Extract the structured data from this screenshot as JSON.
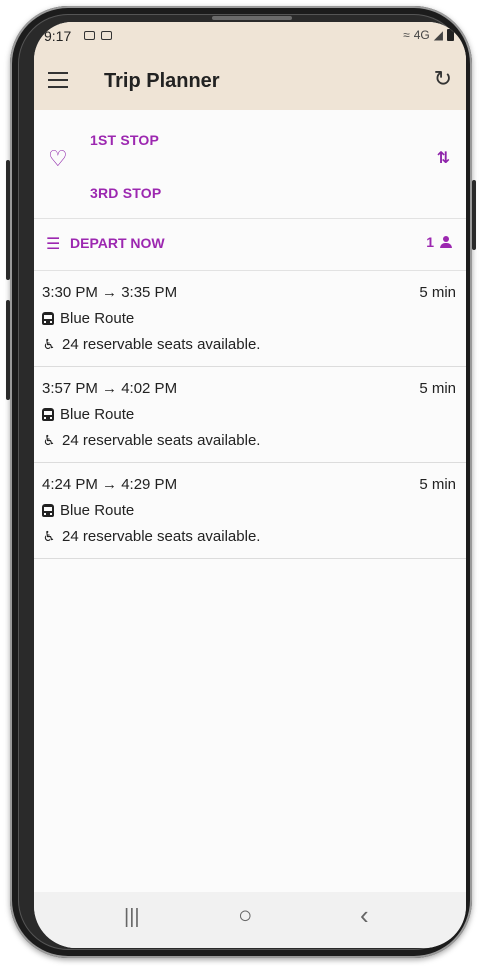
{
  "status_bar": {
    "time": "9:17",
    "signal": "4G"
  },
  "app_bar": {
    "title": "Trip Planner"
  },
  "stops": {
    "origin": "1ST STOP",
    "destination": "3RD STOP"
  },
  "options": {
    "depart": "DEPART NOW",
    "passengers": "1"
  },
  "trips": [
    {
      "time": "3:30 PM → 3:35 PM",
      "duration": "5 min",
      "route": "Blue Route",
      "seats": "24 reservable seats available."
    },
    {
      "time": "3:57 PM → 4:02 PM",
      "duration": "5 min",
      "route": "Blue Route",
      "seats": "24 reservable seats available."
    },
    {
      "time": "4:24 PM → 4:29 PM",
      "duration": "5 min",
      "route": "Blue Route",
      "seats": "24 reservable seats available."
    }
  ],
  "nav_bar": {
    "recents": "|||",
    "home": "○",
    "back": "‹"
  },
  "colors": {
    "accent": "#9c27b0",
    "app_bar": "#efe4d6"
  }
}
